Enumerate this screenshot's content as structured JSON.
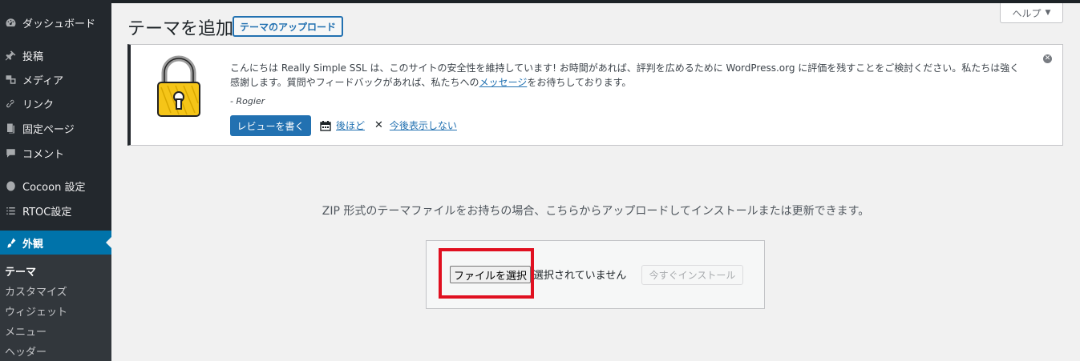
{
  "sidebar": {
    "items": [
      {
        "label": "ダッシュボード",
        "icon": "dashboard-icon"
      },
      {
        "label": "投稿",
        "icon": "pin-icon"
      },
      {
        "label": "メディア",
        "icon": "media-icon"
      },
      {
        "label": "リンク",
        "icon": "link-icon"
      },
      {
        "label": "固定ページ",
        "icon": "page-icon"
      },
      {
        "label": "コメント",
        "icon": "comment-icon"
      },
      {
        "label": "Cocoon 設定",
        "icon": "cocoon-icon"
      },
      {
        "label": "RTOC設定",
        "icon": "list-icon"
      },
      {
        "label": "外観",
        "icon": "appearance-icon"
      }
    ],
    "submenu": [
      "テーマ",
      "カスタマイズ",
      "ウィジェット",
      "メニュー",
      "ヘッダー"
    ]
  },
  "header": {
    "title": "テーマを追加",
    "upload_button": "テーマのアップロード",
    "help": "ヘルプ"
  },
  "notice": {
    "text_before_link": "こんにちは Really Simple SSL は、このサイトの安全性を維持しています! お時間があれば、評判を広めるために WordPress.org に評価を残すことをご検討ください。私たちは強く感謝します。質問やフィードバックがあれば、私たちへの",
    "link_text": "メッセージ",
    "text_after_link": "をお待ちしております。",
    "signature": "- Rogier",
    "review_button": "レビューを書く",
    "later": "後ほど",
    "never": "今後表示しない"
  },
  "upload": {
    "description": "ZIP 形式のテーマファイルをお持ちの場合、こちらからアップロードしてインストールまたは更新できます。",
    "choose_file": "ファイルを選択",
    "no_file": "選択されていません",
    "install_button": "今すぐインストール"
  },
  "colors": {
    "sidebar": "#23282d",
    "active": "#0073aa",
    "accent": "#2271b1",
    "highlight": "#e01020"
  }
}
